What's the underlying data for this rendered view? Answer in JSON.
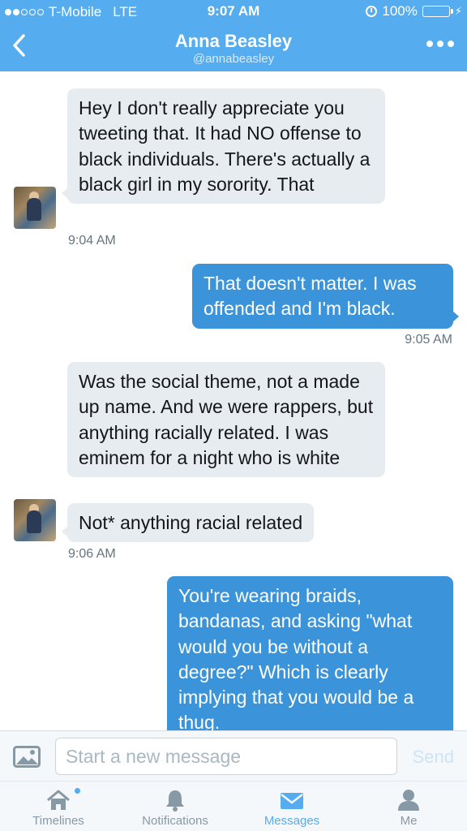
{
  "status_bar": {
    "carrier": "T-Mobile",
    "network": "LTE",
    "time": "9:07 AM",
    "battery": "100%",
    "signal_bars_filled": 2,
    "signal_bars_total": 5
  },
  "header": {
    "name": "Anna Beasley",
    "handle": "@annabeasley",
    "back_icon": "chevron-left-icon",
    "more_icon": "more-dots-icon"
  },
  "messages": [
    {
      "from": "them",
      "text": "Hey I don't really appreciate you tweeting that. It had NO offense to black individuals. There's actually a black girl in my sorority. That",
      "time": "9:04 AM"
    },
    {
      "from": "me",
      "text": "That doesn't matter. I was offended and I'm black.",
      "time": "9:05 AM"
    },
    {
      "from": "them",
      "text": "Was the social theme, not a made up name. And we were rappers, but anything racially related. I was eminem for a night who is white"
    },
    {
      "from": "them",
      "text": "Not* anything racial related",
      "time": "9:06 AM"
    },
    {
      "from": "me",
      "text": "You're wearing braids, bandanas, and asking \"what would you be without a degree?\" Which is clearly implying that you would be a thug."
    }
  ],
  "composer": {
    "placeholder": "Start a new message",
    "send_label": "Send",
    "image_icon": "image-icon"
  },
  "tabs": [
    {
      "label": "Timelines",
      "icon": "home-icon"
    },
    {
      "label": "Notifications",
      "icon": "bell-icon"
    },
    {
      "label": "Messages",
      "icon": "envelope-icon",
      "active": true
    },
    {
      "label": "Me",
      "icon": "person-icon"
    }
  ],
  "colors": {
    "brand": "#55acee",
    "outgoing_bubble": "#3b94d9",
    "incoming_bubble": "#e6ecf0",
    "battery": "#4cd964"
  }
}
